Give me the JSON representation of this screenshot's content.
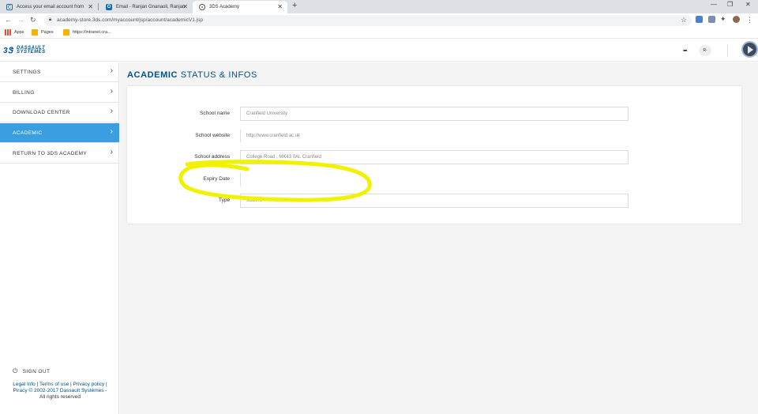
{
  "browser": {
    "tabs": [
      {
        "title": "Access your email account from"
      },
      {
        "title": "Email - Ranjan Gnanaoli, Ranjan"
      },
      {
        "title": "3DS Academy"
      }
    ],
    "new_tab": "+",
    "url": "academy-store.3ds.com/myaccount/jsp/account/academicV1.jsp",
    "bookmarks": [
      {
        "label": "Apps"
      },
      {
        "label": "Pages"
      },
      {
        "label": "https://intranet.cra..."
      }
    ]
  },
  "header": {
    "logo_line1": "DASSAULT",
    "logo_line2": "SYSTEMES",
    "user_initials": "R-"
  },
  "sidebar": {
    "items": [
      {
        "label": "SETTINGS",
        "active": false
      },
      {
        "label": "BILLING",
        "active": false
      },
      {
        "label": "DOWNLOAD CENTER",
        "active": false
      },
      {
        "label": "ACADEMIC",
        "active": true
      },
      {
        "label": "RETURN TO 3DS ACADEMY",
        "active": false
      }
    ],
    "sign_out": "SIGN OUT",
    "legal": {
      "legal_info": "Legal Info",
      "terms": "Terms of use",
      "privacy": "Privacy policy",
      "copyright": "Piracy © 2002-2017 Dassault Systèmes -",
      "rights": "All rights reserved"
    }
  },
  "main": {
    "title_bold": "ACADEMIC",
    "title_light": "STATUS & INFOS",
    "fields": [
      {
        "label": "School name",
        "value": "Cranfield University"
      },
      {
        "label": "School website",
        "value": "http://www.cranfield.ac.uk"
      },
      {
        "label": "School address",
        "value": "College Road , MK43 0AL Cranfield"
      },
      {
        "label": "Expiry Date",
        "value": ""
      },
      {
        "label": "Type",
        "value": "student"
      }
    ]
  },
  "colors": {
    "brand": "#005386",
    "active": "#3a9ee0",
    "highlight": "#f2f200"
  }
}
